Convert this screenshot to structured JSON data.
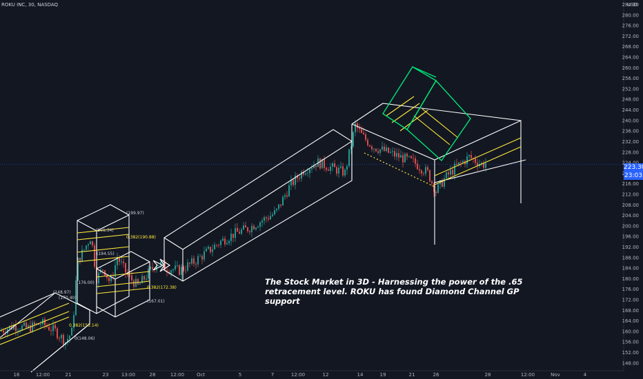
{
  "header": {
    "symbol": "ROKU INC, 30, NASDAQ",
    "currency": "USD"
  },
  "annotation": {
    "text": "The Stock Market in 3D - Harnessing the power of the .65 retracement level. ROKU has found Diamond Channel GP support"
  },
  "price_tags": {
    "last": "223.30",
    "secondary": "23:03"
  },
  "colors": {
    "background": "#131722",
    "up": "#26a69a",
    "down": "#ef5350",
    "fib": "#ffeb3b",
    "box": "#ffffff",
    "green_box": "#00e676",
    "last_price": "#2962ff"
  },
  "chart_data": {
    "type": "candlestick",
    "title": "ROKU INC, 30, NASDAQ",
    "y_axis": {
      "side": "right",
      "ylim": [
        146,
        284
      ],
      "ticks": [
        148.0,
        152.0,
        156.0,
        160.0,
        164.0,
        168.0,
        172.0,
        176.0,
        180.0,
        184.0,
        188.0,
        192.0,
        196.0,
        200.0,
        204.0,
        208.0,
        212.0,
        216.0,
        220.0,
        224.0,
        228.0,
        232.0,
        236.0,
        240.0,
        244.0,
        248.0,
        252.0,
        256.0,
        260.0,
        264.0,
        268.0,
        272.0,
        276.0,
        280.0,
        284.0
      ]
    },
    "x_axis": {
      "tick_labels": [
        "16",
        "12:00",
        "21",
        "23",
        "13:00",
        "28",
        "12:00",
        "Oct",
        "5",
        "7",
        "12:00",
        "12",
        "14",
        "19",
        "21",
        "26",
        "28",
        "12:00",
        "Nov",
        "4"
      ]
    },
    "price_path": [
      [
        0,
        160
      ],
      [
        20,
        162
      ],
      [
        40,
        161
      ],
      [
        60,
        163
      ],
      [
        80,
        160
      ],
      [
        95,
        156
      ],
      [
        105,
        160
      ],
      [
        112,
        186
      ],
      [
        122,
        191
      ],
      [
        132,
        196
      ],
      [
        140,
        180
      ],
      [
        150,
        184
      ],
      [
        160,
        178
      ],
      [
        170,
        188
      ],
      [
        185,
        181
      ],
      [
        200,
        177
      ],
      [
        215,
        182
      ],
      [
        228,
        186
      ],
      [
        240,
        184
      ],
      [
        260,
        183
      ],
      [
        280,
        186
      ],
      [
        300,
        190
      ],
      [
        320,
        194
      ],
      [
        340,
        197
      ],
      [
        360,
        199
      ],
      [
        380,
        202
      ],
      [
        400,
        205
      ],
      [
        420,
        215
      ],
      [
        440,
        221
      ],
      [
        460,
        224
      ],
      [
        480,
        222
      ],
      [
        500,
        220
      ],
      [
        505,
        226
      ],
      [
        515,
        238
      ],
      [
        525,
        234
      ],
      [
        540,
        230
      ],
      [
        560,
        228
      ],
      [
        580,
        226
      ],
      [
        600,
        224
      ],
      [
        620,
        220
      ],
      [
        632,
        213
      ],
      [
        645,
        218
      ],
      [
        660,
        222
      ],
      [
        680,
        226
      ],
      [
        700,
        223
      ],
      [
        705,
        224
      ]
    ],
    "fib_levels": [
      {
        "label": "0.382(153.14)",
        "value": 153.14
      },
      {
        "label": "0(148.06)",
        "value": 148.06
      },
      {
        "label": "0.382(190.88)",
        "value": 190.88
      },
      {
        "label": "(199.97)",
        "value": 199.97
      },
      {
        "label": "(194.55)",
        "value": 194.55
      },
      {
        "label": "(176.00)",
        "value": 176.0
      },
      {
        "label": "0.382(172.38)",
        "value": 172.38
      },
      {
        "label": "(167.01)",
        "value": 167.01
      },
      {
        "label": "(201.34)",
        "value": 201.34
      },
      {
        "label": "(170.40)",
        "value": 170.4
      },
      {
        "label": "(148.97)",
        "value": 148.97
      }
    ],
    "last_price": 223.3,
    "grid": false,
    "legend": "none"
  }
}
